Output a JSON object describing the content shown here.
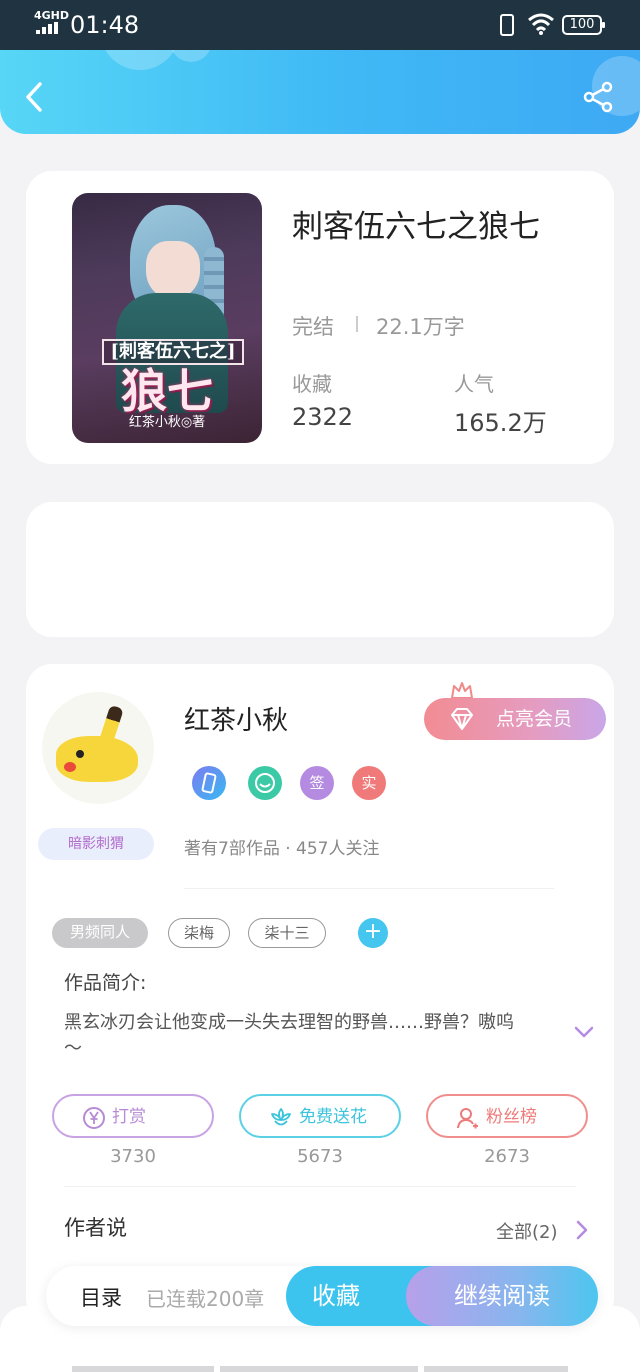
{
  "status_bar": {
    "network": "4GHD",
    "time": "01:48",
    "battery": "100"
  },
  "book": {
    "cover": {
      "subtitle": "[刺客伍六七之]",
      "big_title": "狼七",
      "author_line": "红茶小秋◎著"
    },
    "title": "刺客伍六七之狼七",
    "status": "完结",
    "word_count": "22.1万字",
    "favorites_label": "收藏",
    "favorites_value": "2322",
    "popularity_label": "人气",
    "popularity_value": "165.2万"
  },
  "author": {
    "name": "红茶小秋",
    "vip_button": "点亮会员",
    "badges": [
      "phone-badge-icon",
      "smile-badge-icon",
      "签",
      "实"
    ],
    "fan_title": "暗影刺猬",
    "meta": "著有7部作品 · 457人关注"
  },
  "tags": [
    "男频同人",
    "柒梅",
    "柒十三"
  ],
  "intro": {
    "label": "作品简介:",
    "text": "黑玄冰刃会让他变成一头失去理智的野兽……野兽？嗷呜～"
  },
  "actions": [
    {
      "label": "打赏",
      "count": "3730",
      "icon": "yen-icon",
      "color": "#b78ad6"
    },
    {
      "label": "免费送花",
      "count": "5673",
      "icon": "flower-icon",
      "color": "#3cc4dc"
    },
    {
      "label": "粉丝榜",
      "count": "2673",
      "icon": "fans-icon",
      "color": "#ef7a7a"
    }
  ],
  "author_say": {
    "label": "作者说",
    "see_all": "全部(2)"
  },
  "bottom_bar": {
    "toc": "目录",
    "serial": "已连载200章",
    "favorite": "收藏",
    "continue": "继续阅读"
  },
  "colors": {
    "accent": "#3fb8f5",
    "vip": "#e98fa8"
  }
}
